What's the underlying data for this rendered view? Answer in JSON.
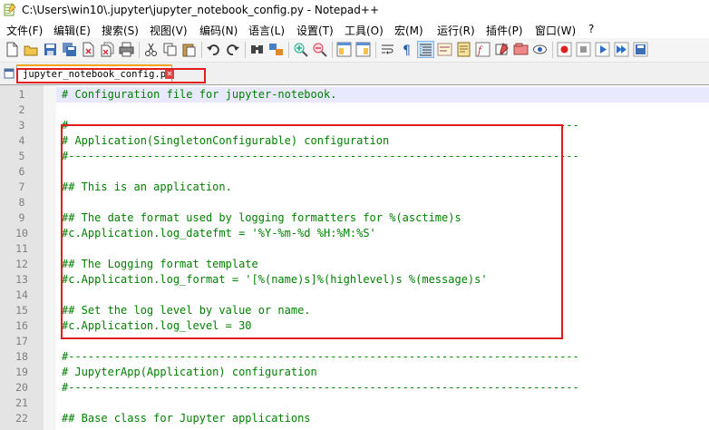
{
  "window": {
    "title": "C:\\Users\\win10\\.jupyter\\jupyter_notebook_config.py - Notepad++"
  },
  "menu": [
    "文件(F)",
    "编辑(E)",
    "搜索(S)",
    "视图(V)",
    "编码(N)",
    "语言(L)",
    "设置(T)",
    "工具(O)",
    "宏(M)",
    "运行(R)",
    "插件(P)",
    "窗口(W)",
    "?"
  ],
  "tab": {
    "label": "jupyter_notebook_config.py",
    "close": "✕"
  },
  "editor": {
    "lines": [
      {
        "n": "1",
        "text": "# Configuration file for jupyter-notebook."
      },
      {
        "n": "2",
        "text": ""
      },
      {
        "n": "3",
        "text": "#------------------------------------------------------------------------------"
      },
      {
        "n": "4",
        "text": "# Application(SingletonConfigurable) configuration"
      },
      {
        "n": "5",
        "text": "#------------------------------------------------------------------------------"
      },
      {
        "n": "6",
        "text": ""
      },
      {
        "n": "7",
        "text": "## This is an application."
      },
      {
        "n": "8",
        "text": ""
      },
      {
        "n": "9",
        "text": "## The date format used by logging formatters for %(asctime)s"
      },
      {
        "n": "10",
        "text": "#c.Application.log_datefmt = '%Y-%m-%d %H:%M:%S'"
      },
      {
        "n": "11",
        "text": ""
      },
      {
        "n": "12",
        "text": "## The Logging format template"
      },
      {
        "n": "13",
        "text": "#c.Application.log_format = '[%(name)s]%(highlevel)s %(message)s'"
      },
      {
        "n": "14",
        "text": ""
      },
      {
        "n": "15",
        "text": "## Set the log level by value or name."
      },
      {
        "n": "16",
        "text": "#c.Application.log_level = 30"
      },
      {
        "n": "17",
        "text": ""
      },
      {
        "n": "18",
        "text": "#------------------------------------------------------------------------------"
      },
      {
        "n": "19",
        "text": "# JupyterApp(Application) configuration"
      },
      {
        "n": "20",
        "text": "#------------------------------------------------------------------------------"
      },
      {
        "n": "21",
        "text": ""
      },
      {
        "n": "22",
        "text": "## Base class for Jupyter applications"
      }
    ]
  }
}
